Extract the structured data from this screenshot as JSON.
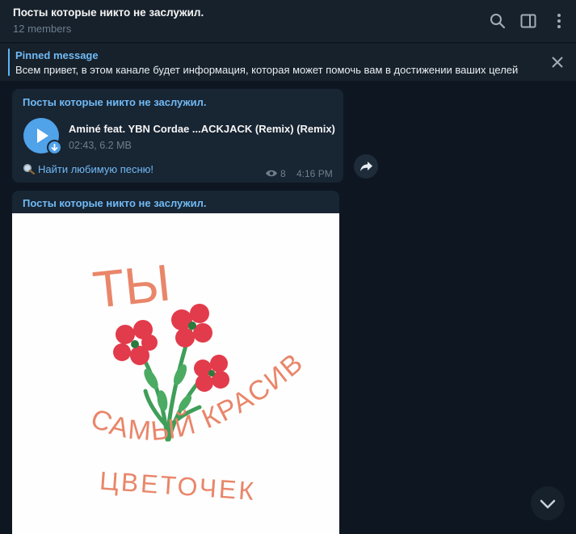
{
  "header": {
    "title": "Посты которые никто не заслужил.",
    "subtitle": "12 members",
    "icons": [
      "search-icon",
      "sidebar-toggle-icon",
      "more-vertical-icon"
    ]
  },
  "pinned": {
    "label": "Pinned message",
    "text": "Всем привет, в этом канале будет информация, которая может помочь вам в достижении ваших целей"
  },
  "messages": [
    {
      "author": "Посты которые никто не заслужил.",
      "audio": {
        "title": "Aminé feat. YBN Cordae ...ACKJACK (Remix) (Remix)",
        "meta": "02:43, 6.2 MB"
      },
      "link_text": "Найти любимую песню!",
      "views": "8",
      "time": "4:16 PM"
    },
    {
      "author": "Посты которые никто не заслужил.",
      "photo": {
        "top_text": "ТЫ",
        "arc_text": "САМЫЙ КРАСИВЫЙ",
        "bottom_text": "ЦВЕТОЧЕК"
      }
    }
  ],
  "colors": {
    "background": "#0e1621",
    "header": "#17212b",
    "bubble": "#182533",
    "accent": "#71baf5",
    "muted": "#6d7f8f"
  }
}
